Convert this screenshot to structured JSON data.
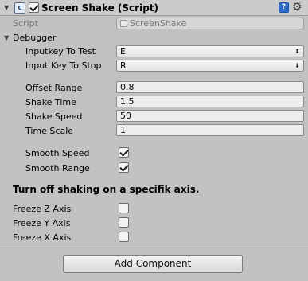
{
  "component": {
    "title": "Screen Shake (Script)",
    "enabled": true,
    "icons": {
      "fold": "fold-down-arrow",
      "script": "cs-script-icon",
      "help": "help-book-icon",
      "settings": "gear-icon"
    }
  },
  "script": {
    "label": "Script",
    "value": "ScreenShake"
  },
  "debugger": {
    "label": "Debugger"
  },
  "fields": {
    "input_test": {
      "label": "Inputkey To Test",
      "value": "E"
    },
    "input_stop": {
      "label": "Input Key To Stop",
      "value": "R"
    },
    "offset_range": {
      "label": "Offset Range",
      "value": "0.8"
    },
    "shake_time": {
      "label": "Shake Time",
      "value": "1.5"
    },
    "shake_speed": {
      "label": "Shake Speed",
      "value": "50"
    },
    "time_scale": {
      "label": "Time Scale",
      "value": "1"
    },
    "smooth_speed": {
      "label": "Smooth Speed",
      "checked": true
    },
    "smooth_range": {
      "label": "Smooth Range",
      "checked": true
    }
  },
  "axis_section": {
    "text": "Turn off shaking on a specifik axis."
  },
  "freeze": {
    "z": {
      "label": "Freeze Z Axis",
      "checked": false
    },
    "y": {
      "label": "Freeze Y Axis",
      "checked": false
    },
    "x": {
      "label": "Freeze X Axis",
      "checked": false
    }
  },
  "add_component": {
    "label": "Add Component"
  }
}
